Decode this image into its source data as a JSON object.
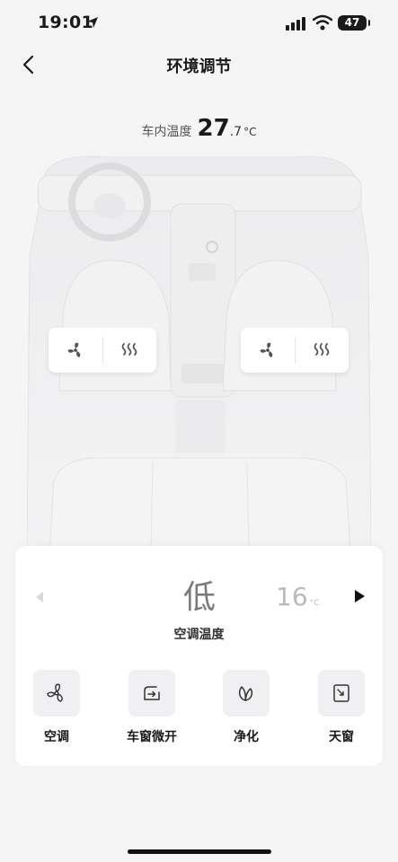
{
  "status_bar": {
    "time": "19:01",
    "battery": "47"
  },
  "header": {
    "title": "环境调节"
  },
  "cabin": {
    "temp_label": "车内温度",
    "temp_int": "27",
    "temp_dec": ".7",
    "temp_unit": "°C"
  },
  "seats": {
    "left": {
      "fan_icon": "fan-icon",
      "heat_icon": "seat-heat-icon"
    },
    "right": {
      "fan_icon": "fan-icon",
      "heat_icon": "seat-heat-icon"
    }
  },
  "climate": {
    "fan_level": "低",
    "set_temp": "16",
    "set_temp_unit": "°C",
    "label": "空调温度"
  },
  "functions": [
    {
      "label": "空调",
      "icon": "fan-icon"
    },
    {
      "label": "车窗微开",
      "icon": "window-vent-icon"
    },
    {
      "label": "净化",
      "icon": "leaf-icon"
    },
    {
      "label": "天窗",
      "icon": "sunroof-icon"
    }
  ],
  "colors": {
    "background": "#f5f5f6",
    "panel": "#ffffff",
    "tile": "#f0f0f2",
    "muted": "#b9b9b9"
  }
}
